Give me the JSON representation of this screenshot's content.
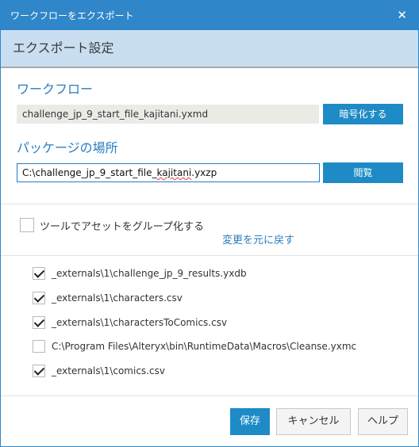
{
  "window": {
    "title": "ワークフローをエクスポート",
    "close_glyph": "✕"
  },
  "header": {
    "title": "エクスポート設定"
  },
  "workflow": {
    "label": "ワークフロー",
    "value": "challenge_jp_9_start_file_kajitani.yxmd",
    "encrypt_label": "暗号化する"
  },
  "package": {
    "label": "パッケージの場所",
    "value_prefix": "C:\\challenge_jp_9_start_file_",
    "value_flagged": "kajitani",
    "value_suffix": ".yxzp",
    "browse_label": "閲覧"
  },
  "group_option": {
    "label": "ツールでアセットをグループ化する",
    "checked": false,
    "revert_label": "変更を元に戻す"
  },
  "files": [
    {
      "label": "_externals\\1\\challenge_jp_9_results.yxdb",
      "checked": true
    },
    {
      "label": "_externals\\1\\characters.csv",
      "checked": true
    },
    {
      "label": "_externals\\1\\charactersToComics.csv",
      "checked": true
    },
    {
      "label": "C:\\Program Files\\Alteryx\\bin\\RuntimeData\\Macros\\Cleanse.yxmc",
      "checked": false
    },
    {
      "label": "_externals\\1\\comics.csv",
      "checked": true
    }
  ],
  "footer": {
    "save_label": "保存",
    "cancel_label": "キャンセル",
    "help_label": "ヘルプ"
  },
  "colors": {
    "accent": "#1e8bc6",
    "titlebar": "#2f86c8",
    "header_bg": "#c9def0"
  }
}
